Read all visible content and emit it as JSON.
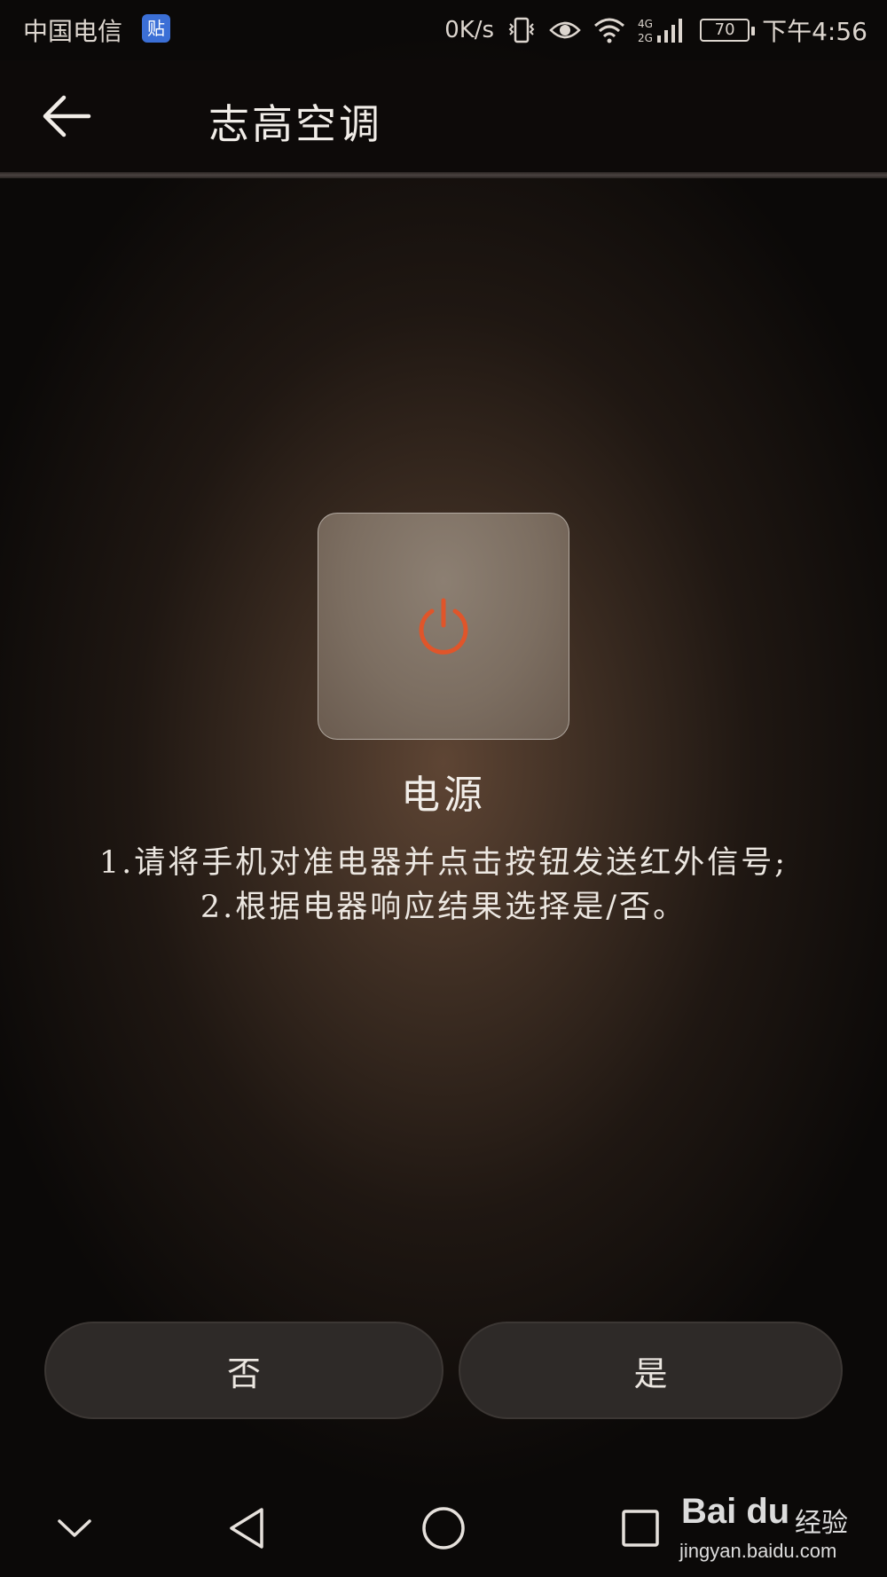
{
  "status_bar": {
    "carrier": "中国电信",
    "badge": "贴",
    "net_speed": "0K/s",
    "battery": "70",
    "time": "下午4:56",
    "icons": [
      "vibrate-icon",
      "eye-icon",
      "wifi-icon",
      "signal-4g-icon",
      "battery-icon"
    ]
  },
  "header": {
    "title": "志高空调",
    "back_icon": "arrow-left-icon"
  },
  "key": {
    "icon": "power-icon",
    "icon_color": "#e0552a",
    "label": "电源"
  },
  "instructions": [
    "1.请将手机对准电器并点击按钮发送红外信号;",
    "2.根据电器响应结果选择是/否。"
  ],
  "buttons": {
    "no_label": "否",
    "yes_label": "是"
  },
  "nav": {
    "icons": [
      "chevron-down-icon",
      "back-triangle-icon",
      "home-circle-icon",
      "recents-square-icon"
    ]
  },
  "watermark": {
    "logo": "Bai du",
    "text": "经验",
    "url": "jingyan.baidu.com"
  }
}
